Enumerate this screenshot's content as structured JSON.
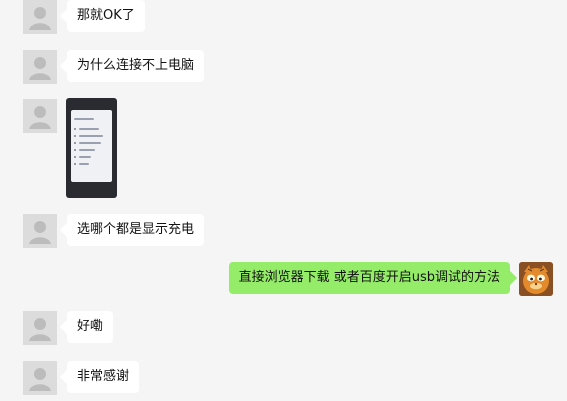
{
  "messages": [
    {
      "sender": "other",
      "text": "那就OK了"
    },
    {
      "sender": "other",
      "text": "为什么连接不上电脑"
    },
    {
      "sender": "other",
      "type": "image",
      "image_icon": "phone-screenshot-icon"
    },
    {
      "sender": "other",
      "text": "选哪个都是显示充电"
    },
    {
      "sender": "me",
      "text": "直接浏览器下载 或者百度开启usb调试的方法"
    },
    {
      "sender": "other",
      "text": "好嘞"
    },
    {
      "sender": "other",
      "text": "非常感谢"
    }
  ],
  "colors": {
    "background": "#f5f5f5",
    "bubble_other": "#ffffff",
    "bubble_me": "#95ec69",
    "avatar_placeholder": "#dcdcdc"
  },
  "icons": {
    "other_avatar": "default-user-avatar-icon",
    "me_avatar": "garfield-cat-avatar-icon"
  }
}
